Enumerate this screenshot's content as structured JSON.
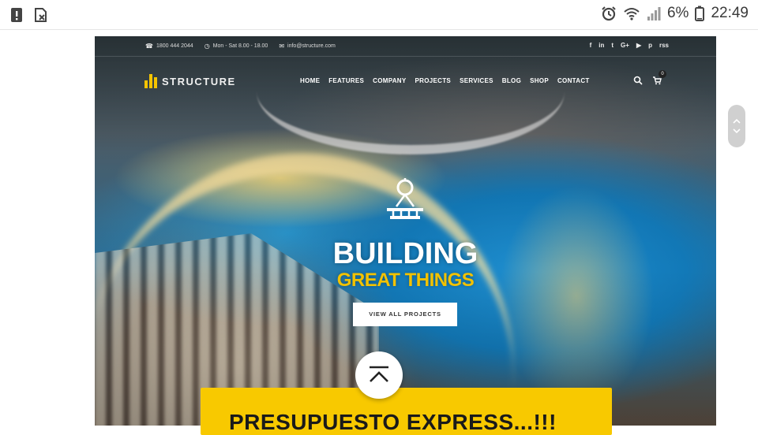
{
  "status_bar": {
    "left_icons": [
      "alert-icon",
      "blocked-sim-icon"
    ],
    "right_icons": [
      "alarm-icon",
      "wifi-icon",
      "signal-icon",
      "battery-icon"
    ],
    "battery": "6%",
    "time": "22:49"
  },
  "site": {
    "topbar": {
      "phone": "1800 444 2044",
      "hours": "Mon - Sat 8.00 - 18.00",
      "email": "info@structure.com",
      "socials": [
        "f",
        "in",
        "t",
        "G+",
        "▶",
        "p",
        "rss"
      ]
    },
    "logo": "STRUCTURE",
    "nav": [
      "HOME",
      "FEATURES",
      "COMPANY",
      "PROJECTS",
      "SERVICES",
      "BLOG",
      "SHOP",
      "CONTACT"
    ],
    "cart_count": "0",
    "hero": {
      "title": "BUILDING",
      "subtitle": "GREAT THINGS",
      "button": "VIEW ALL PROJECTS"
    },
    "banner": "PRESUPUESTO EXPRESS...!!!"
  },
  "colors": {
    "accent": "#f8c900",
    "hero_subtitle": "#f2c200",
    "status_text": "#3a3a3a"
  }
}
